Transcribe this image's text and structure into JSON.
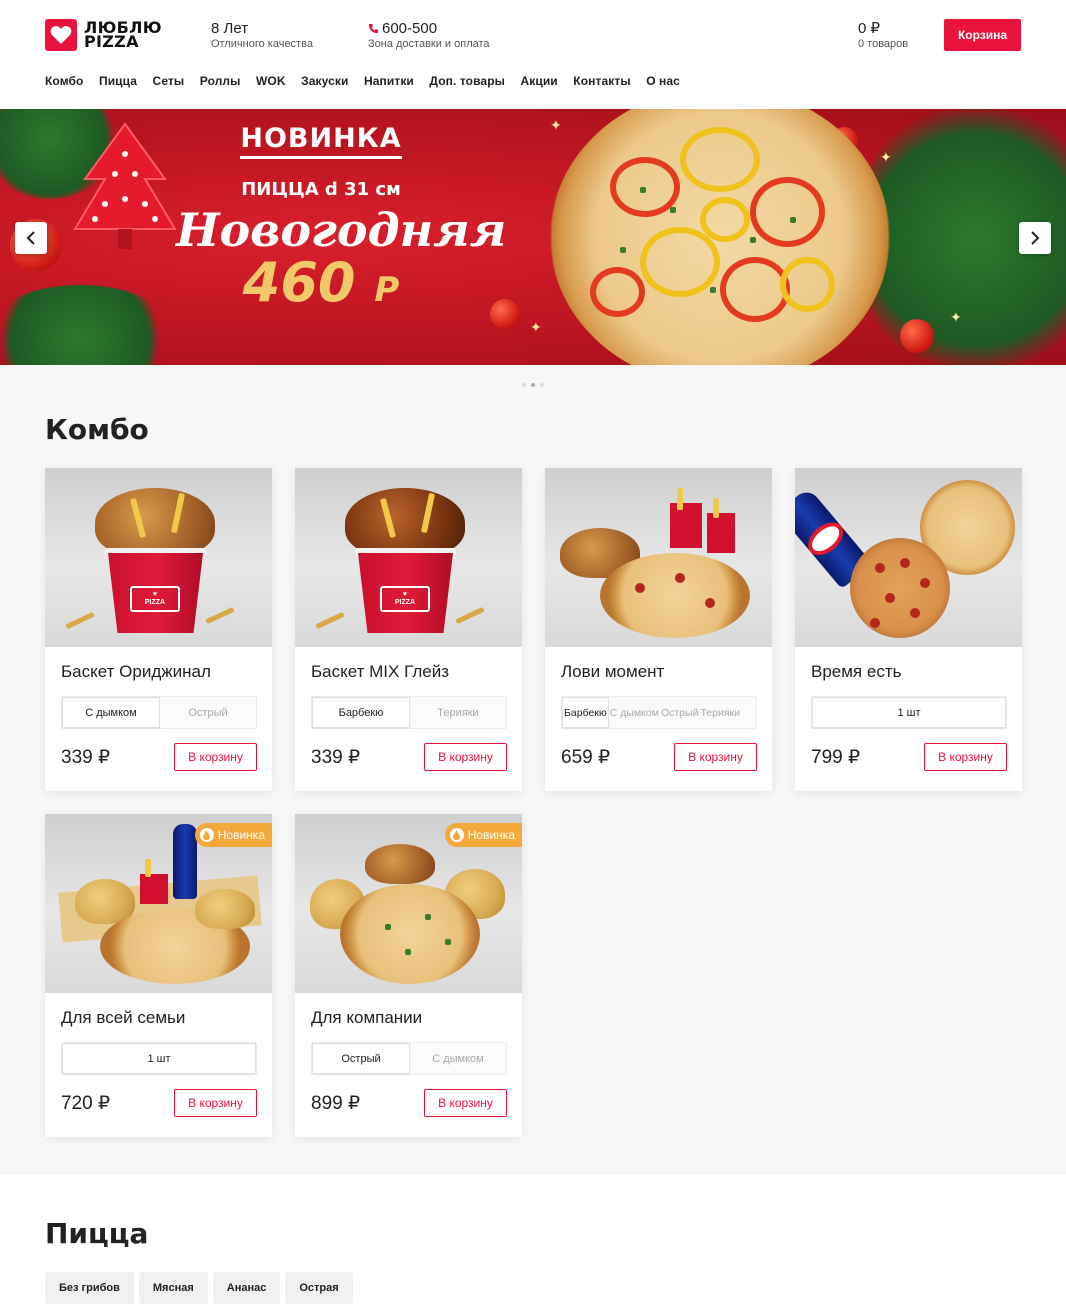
{
  "brand": {
    "line1": "ЛЮБЛЮ",
    "line2": "PIZZA",
    "color": "#e8123c"
  },
  "header": {
    "years_title": "8 Лет",
    "years_sub": "Отличного качества",
    "phone": "600-500",
    "phone_sub": "Зона доставки и оплата",
    "cart_sum": "0 ₽",
    "cart_count": "0 товаров",
    "cart_button": "Корзина"
  },
  "nav": [
    "Комбо",
    "Пицца",
    "Сеты",
    "Роллы",
    "WOK",
    "Закуски",
    "Напитки",
    "Доп. товары",
    "Акции",
    "Контакты",
    "О нас"
  ],
  "banner": {
    "badge": "НОВИНКА",
    "subtitle": "ПИЦЦА d 31 см",
    "name": "Новогодняя",
    "price": "460",
    "currency": "Р",
    "prev_icon": "chevron-left-icon",
    "next_icon": "chevron-right-icon",
    "slides_total": 3,
    "slide_active": 2
  },
  "combo": {
    "title": "Комбо",
    "add_label": "В корзину",
    "new_label": "Новинка",
    "items": [
      {
        "name": "Баскет Ориджинал",
        "options": [
          "С дымком",
          "Острый"
        ],
        "selected": 0,
        "price": "339 ₽",
        "is_new": false
      },
      {
        "name": "Баскет MIX Глейз",
        "options": [
          "Барбекю",
          "Терияки"
        ],
        "selected": 0,
        "price": "339 ₽",
        "is_new": false
      },
      {
        "name": "Лови момент",
        "options": [
          "Барбекю",
          "С дымком",
          "Острый",
          "Терияки"
        ],
        "selected": 0,
        "price": "659 ₽",
        "is_new": false
      },
      {
        "name": "Время есть",
        "options": [
          "1 шт"
        ],
        "selected": 0,
        "price": "799 ₽",
        "is_new": false
      },
      {
        "name": "Для всей семьи",
        "options": [
          "1 шт"
        ],
        "selected": 0,
        "price": "720 ₽",
        "is_new": true
      },
      {
        "name": "Для компании",
        "options": [
          "Острый",
          "С дымком"
        ],
        "selected": 0,
        "price": "899 ₽",
        "is_new": true
      }
    ]
  },
  "pizza": {
    "title": "Пицца",
    "filters": [
      "Без грибов",
      "Мясная",
      "Ананас",
      "Острая"
    ]
  }
}
